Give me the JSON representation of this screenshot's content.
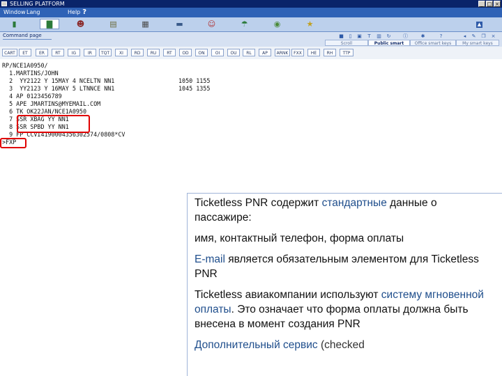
{
  "window": {
    "title": "SELLING PLATFORM",
    "buttons": [
      "_",
      "□",
      "×"
    ]
  },
  "menu": {
    "items": [
      {
        "label": "Window",
        "mark": ""
      },
      {
        "label": "Lang",
        "mark": ""
      },
      {
        "label": "Help",
        "mark": "?"
      }
    ]
  },
  "toolbar": {
    "icons": [
      "book-icon",
      "folder-icon",
      "person-icon",
      "clipboard-icon",
      "calendar-icon",
      "car-icon",
      "user-icon",
      "umbrella-icon",
      "globe-icon",
      "star-icon"
    ]
  },
  "page": {
    "title": "Command page",
    "tabs": [
      "Scroll",
      "Public smart keys",
      "Office smart keys",
      "My smart keys"
    ]
  },
  "commands": [
    "CART",
    "ET",
    "ER",
    "RT",
    "IG",
    "IR",
    "TQT",
    "XI",
    "RD",
    "RU",
    "RT",
    "OD",
    "ON",
    "OI",
    "OU",
    "RL",
    "AP",
    "ARNK",
    "FXX",
    "HE",
    "RH",
    "TTP"
  ],
  "terminal": {
    "lines": [
      "RP/NCE1A0950/",
      "  1.MARTINS/JOHN",
      "  2  YY2122 Y 15MAY 4 NCELTN NN1",
      "  3  YY2123 Y 16MAY 5 LTNNCE NN1",
      "  4 AP 0123456789",
      "  5 APE JMARTINS@MYEMAIL.COM",
      "  6 TK OK22JAN/NCE1A0950",
      "  7 SSR XBAG YY NN1",
      "  8 SSR SPBD YY NN1",
      "  9 FP CCVI4190004356302574/0808*CV",
      ">FXP"
    ],
    "times": [
      "1050 1155",
      "1045 1355"
    ]
  },
  "note": {
    "p1_a": "Ticketless PNR содержит ",
    "p1_b": "стандартные",
    "p1_c": " данные о пассажире:",
    "p2": "имя, контактный телефон, форма оплаты",
    "p3_a": "E-mail",
    "p3_b": " является обязательным элементом для Ticketless PNR",
    "p4_a": "Ticketless авиакомпании используют ",
    "p4_b": "систему мгновенной оплаты",
    "p4_c": ". Это означает что форма оплаты должна быть внесена в момент создания PNR",
    "p5_a": "Дополнительный сервис",
    "p5_b": " (checked"
  },
  "colors": {
    "titlebar": "#0a246a",
    "menubar": "#2f62b6",
    "highlight": "#e00000",
    "accent": "#1f4e8c"
  }
}
